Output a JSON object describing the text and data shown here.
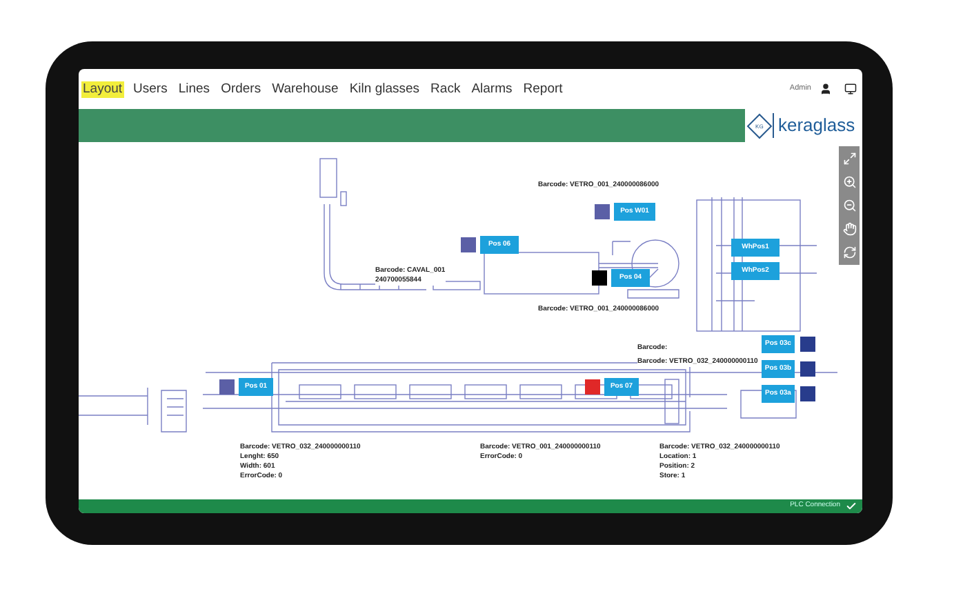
{
  "nav": [
    {
      "label": "Layout",
      "selected": true
    },
    {
      "label": "Users",
      "selected": false
    },
    {
      "label": "Lines",
      "selected": false
    },
    {
      "label": "Orders",
      "selected": false
    },
    {
      "label": "Warehouse",
      "selected": false
    },
    {
      "label": "Kiln glasses",
      "selected": false
    },
    {
      "label": "Rack",
      "selected": false
    },
    {
      "label": "Alarms",
      "selected": false
    },
    {
      "label": "Report",
      "selected": false
    }
  ],
  "user": "Admin",
  "logo": {
    "mark": "KG",
    "name": "keraglass"
  },
  "positions": [
    {
      "label": "Pos W01",
      "color": "#5b5fa6"
    },
    {
      "label": "Pos 06",
      "color": "#5b5fa6"
    },
    {
      "label": "Pos 04",
      "color": "#000000"
    },
    {
      "label": "WhPos1"
    },
    {
      "label": "WhPos2"
    },
    {
      "label": "Pos 03c",
      "color": "#283c8c"
    },
    {
      "label": "Pos 03b",
      "color": "#283c8c"
    },
    {
      "label": "Pos 03a",
      "color": "#283c8c"
    },
    {
      "label": "Pos 01",
      "color": "#5b5fa6"
    },
    {
      "label": "Pos 07",
      "color": "#e02828"
    }
  ],
  "labels": [
    {
      "lines": [
        "Barcode: VETRO_001_240000086000"
      ]
    },
    {
      "lines": [
        "Barcode: CAVAL_001",
        "240700055844"
      ]
    },
    {
      "lines": [
        "Barcode: VETRO_001_240000086000"
      ]
    },
    {
      "lines": [
        "Barcode:"
      ]
    },
    {
      "lines": [
        "Barcode: VETRO_032_240000000110"
      ]
    },
    {
      "lines": [
        "Barcode: VETRO_032_240000000110",
        "Lenght: 650",
        "Width: 601",
        "ErrorCode: 0"
      ]
    },
    {
      "lines": [
        "Barcode: VETRO_001_240000000110",
        "ErrorCode: 0"
      ]
    },
    {
      "lines": [
        "Barcode: VETRO_032_240000000110",
        "Location: 1",
        "Position: 2",
        "Store: 1"
      ]
    }
  ],
  "status": {
    "text": "PLC Connection",
    "connected": true
  }
}
